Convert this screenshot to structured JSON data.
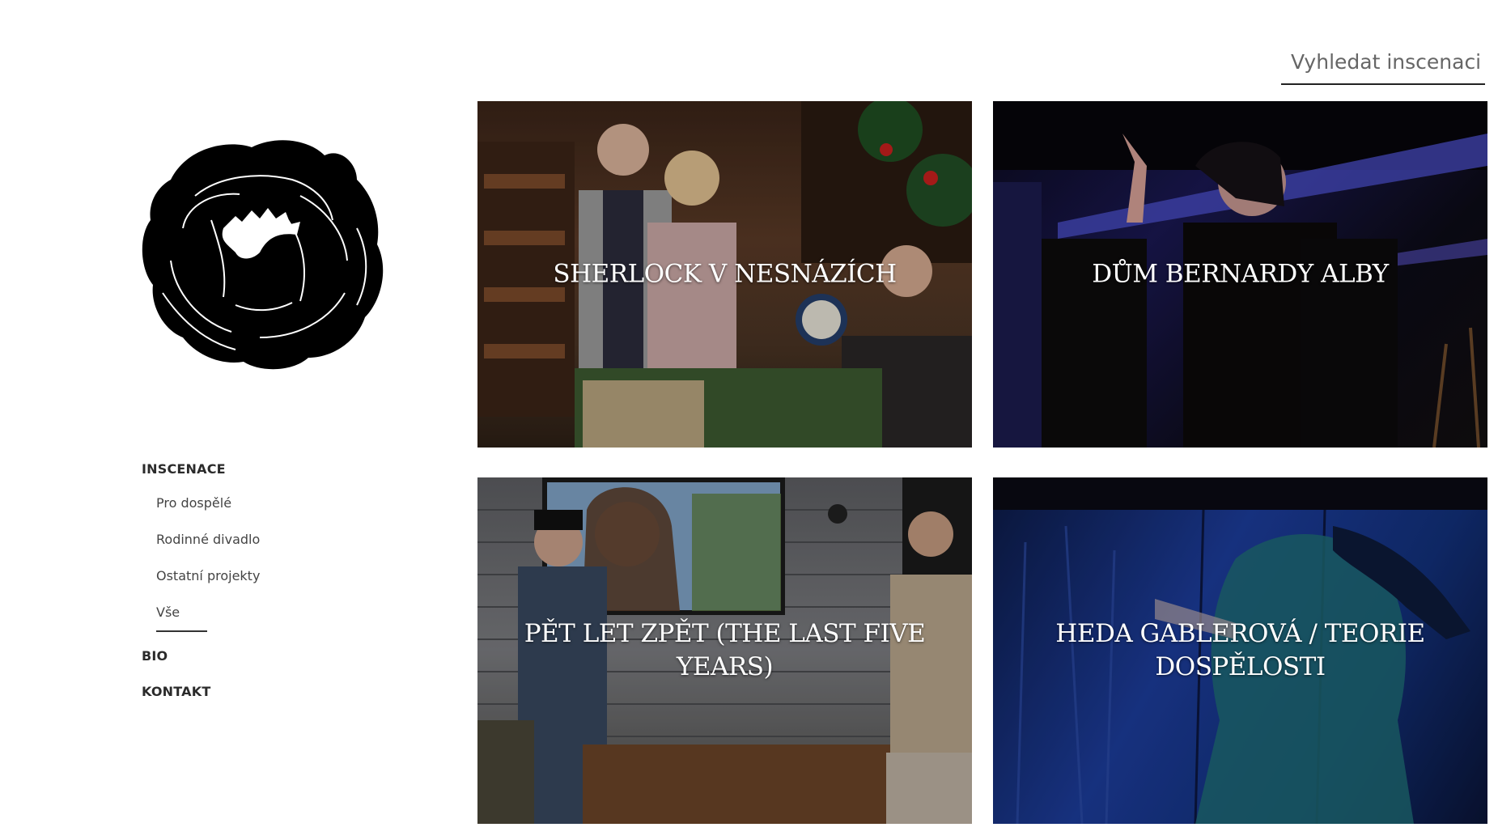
{
  "search": {
    "placeholder": "Vyhledat inscenaci"
  },
  "nav": {
    "inscenace": "INSCENACE",
    "sub": [
      "Pro dospělé",
      "Rodinné divadlo",
      "Ostatní projekty",
      "Vše"
    ],
    "bio": "BIO",
    "kontakt": "KONTAKT"
  },
  "tiles": [
    {
      "title": "SHERLOCK V NESNÁZÍCH"
    },
    {
      "title": "DŮM BERNARDY ALBY"
    },
    {
      "title": "PĚT LET ZPĚT (THE LAST FIVE YEARS)"
    },
    {
      "title": "HEDA GABLEROVÁ / TEORIE DOSPĚLOSTI"
    }
  ],
  "icons": {
    "logo": "peony-flower-logo"
  }
}
